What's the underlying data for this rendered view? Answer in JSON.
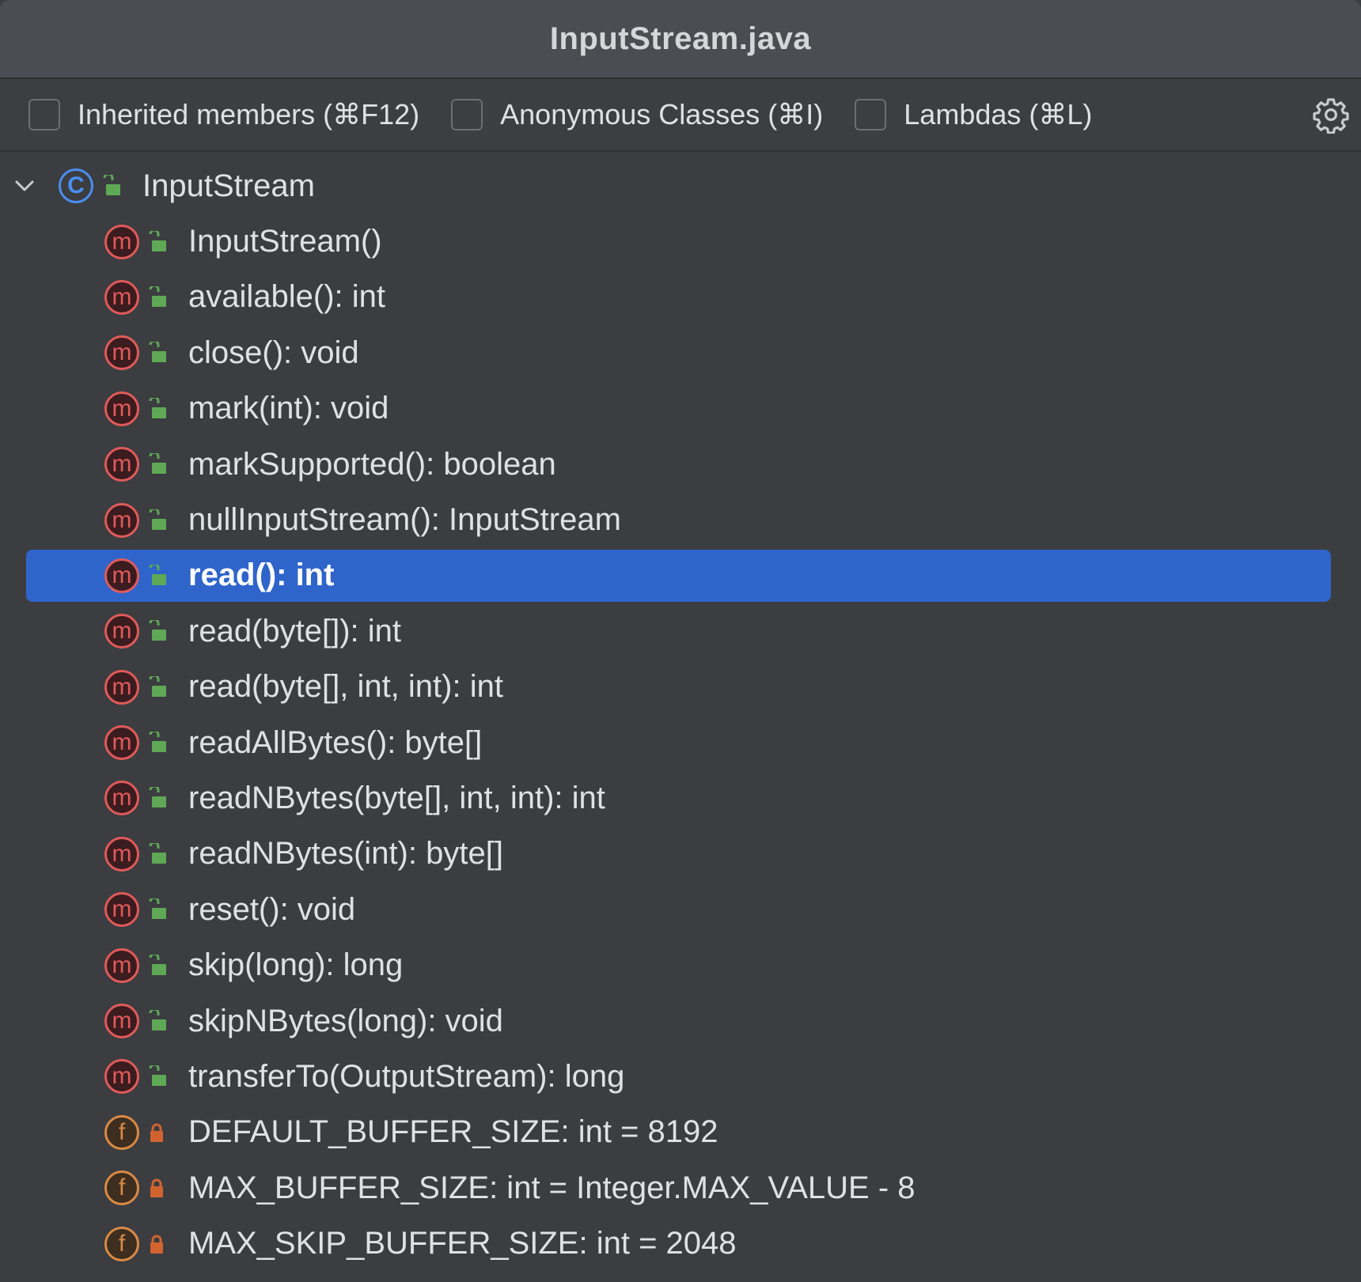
{
  "window": {
    "title": "InputStream.java"
  },
  "toolbar": {
    "options": [
      {
        "label": "Inherited members (⌘F12)",
        "checked": false
      },
      {
        "label": "Anonymous Classes (⌘I)",
        "checked": false
      },
      {
        "label": "Lambdas (⌘L)",
        "checked": false
      }
    ],
    "settings_icon": "gear-icon"
  },
  "tree": {
    "root": {
      "label": "InputStream",
      "kind": "class",
      "visibility": "public",
      "expanded": true
    },
    "members": [
      {
        "label": "InputStream()",
        "kind": "method",
        "visibility": "public"
      },
      {
        "label": "available(): int",
        "kind": "method",
        "visibility": "public"
      },
      {
        "label": "close(): void",
        "kind": "method",
        "visibility": "public"
      },
      {
        "label": "mark(int): void",
        "kind": "method",
        "visibility": "public"
      },
      {
        "label": "markSupported(): boolean",
        "kind": "method",
        "visibility": "public"
      },
      {
        "label": "nullInputStream(): InputStream",
        "kind": "method",
        "visibility": "public"
      },
      {
        "label": "read(): int",
        "kind": "method",
        "visibility": "public",
        "selected": true
      },
      {
        "label": "read(byte[]): int",
        "kind": "method",
        "visibility": "public"
      },
      {
        "label": "read(byte[], int, int): int",
        "kind": "method",
        "visibility": "public"
      },
      {
        "label": "readAllBytes(): byte[]",
        "kind": "method",
        "visibility": "public"
      },
      {
        "label": "readNBytes(byte[], int, int): int",
        "kind": "method",
        "visibility": "public"
      },
      {
        "label": "readNBytes(int): byte[]",
        "kind": "method",
        "visibility": "public"
      },
      {
        "label": "reset(): void",
        "kind": "method",
        "visibility": "public"
      },
      {
        "label": "skip(long): long",
        "kind": "method",
        "visibility": "public"
      },
      {
        "label": "skipNBytes(long): void",
        "kind": "method",
        "visibility": "public"
      },
      {
        "label": "transferTo(OutputStream): long",
        "kind": "method",
        "visibility": "public"
      },
      {
        "label": "DEFAULT_BUFFER_SIZE: int = 8192",
        "kind": "field",
        "visibility": "private"
      },
      {
        "label": "MAX_BUFFER_SIZE: int = Integer.MAX_VALUE - 8",
        "kind": "field",
        "visibility": "private"
      },
      {
        "label": "MAX_SKIP_BUFFER_SIZE: int = 2048",
        "kind": "field",
        "visibility": "private"
      }
    ]
  },
  "icons": {
    "class_letter": "C",
    "method_letter": "m",
    "field_letter": "f"
  },
  "colors": {
    "selection": "#2f65ca",
    "method": "#e05a5a",
    "field": "#d98a44",
    "class": "#4b8ef0",
    "public_lock": "#5fa856",
    "private_lock": "#d2632f"
  }
}
